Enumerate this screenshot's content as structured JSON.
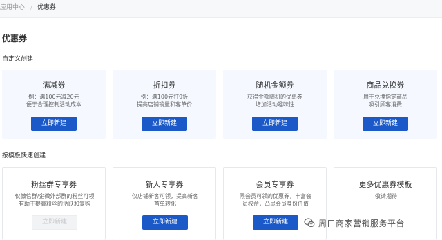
{
  "breadcrumb": {
    "root": "应用中心",
    "separator": "/",
    "current": "优惠券"
  },
  "page_title": "优惠券",
  "custom_section": {
    "title": "自定义创建",
    "cards": [
      {
        "title": "满减券",
        "desc": [
          "例：满100元减20元",
          "便于合理控制活动成本"
        ],
        "button": "立即新建"
      },
      {
        "title": "折扣券",
        "desc": [
          "例：满100元打9折",
          "提高店铺销量和客单价"
        ],
        "button": "立即新建"
      },
      {
        "title": "随机金额券",
        "desc": [
          "获得金额随机的优惠券",
          "增加活动趣味性"
        ],
        "button": "立即新建"
      },
      {
        "title": "商品兑换券",
        "desc": [
          "用于兑换指定商品",
          "吸引顾客消费"
        ],
        "button": "立即新建"
      }
    ]
  },
  "template_section": {
    "title": "按模板快速创建",
    "cards": [
      {
        "title": "粉丝群专享券",
        "desc": [
          "仅微信群/企微外部群的粉丝可领",
          "有助于提高粉丝的活跃和复购"
        ],
        "button": "立即新建",
        "disabled": true
      },
      {
        "title": "新人专享券",
        "desc": [
          "仅店铺新客可领，提高新客",
          "首单转化"
        ],
        "button": "立即新建",
        "disabled": false
      },
      {
        "title": "会员专享券",
        "desc": [
          "限会员可领的优惠券，丰富会",
          "员权益，凸显会员身份价值"
        ],
        "button": "立即新建",
        "disabled": false
      },
      {
        "title": "更多优惠券模板",
        "desc": [
          "敬请期待"
        ],
        "button": null,
        "disabled": false
      }
    ]
  },
  "watermark": {
    "text": "周口商家营销服务平台",
    "icon": "wechat-icon"
  },
  "colors": {
    "primary": "#1b59c8",
    "card_bg": "#f5f8ff",
    "text": "#323233",
    "muted": "#646566"
  }
}
